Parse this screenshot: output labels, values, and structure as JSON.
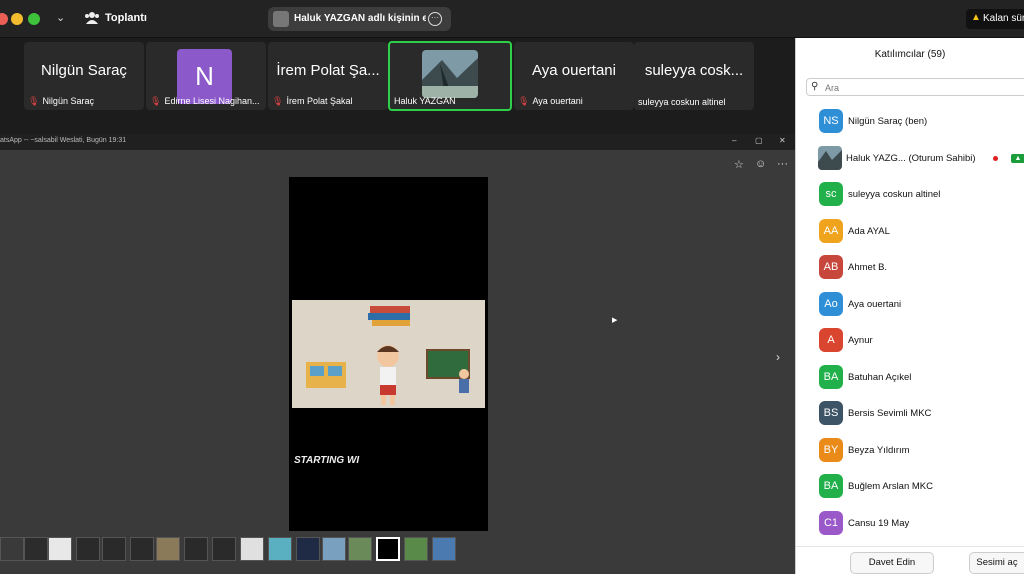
{
  "topbar": {
    "meeting_label": "Toplantı",
    "share_banner": "Haluk YAZGAN adlı kişinin ekranı",
    "time_warning": "Kalan süre"
  },
  "tiles": [
    {
      "name": "Nilgün Saraç",
      "footer": "Nilgün Saraç",
      "muted": true
    },
    {
      "avatar": "N",
      "avatar_color": "#8b59c9",
      "footer": "Edirne Lisesi Nagihan...",
      "muted": true
    },
    {
      "name": "İrem Polat Şa...",
      "footer": "İrem Polat Şakal",
      "muted": true
    },
    {
      "footer": "Haluk YAZGAN",
      "active": true,
      "muted": false
    },
    {
      "name": "Aya ouertani",
      "footer": "Aya ouertani",
      "muted": true
    },
    {
      "name": "suleyya cosk...",
      "footer": "suleyya coskun altinel",
      "muted": false
    }
  ],
  "share": {
    "window_title": "atsApp -- ~salsabil Weslati, Bugün 19:31",
    "video_caption": "STARTING WI"
  },
  "participants": {
    "title": "Katılımcılar (59)",
    "search_placeholder": "Ara",
    "list": [
      {
        "initials": "NS",
        "name": "Nilgün Saraç (ben)",
        "color": "#2f8fd6"
      },
      {
        "initials": "",
        "name": "Haluk YAZG...  (Oturum Sahibi)",
        "color": "#6d6d6d",
        "photo": true
      },
      {
        "initials": "sc",
        "name": "suleyya coskun altinel",
        "color": "#22b04b"
      },
      {
        "initials": "AA",
        "name": "Ada AYAL",
        "color": "#f0a31c"
      },
      {
        "initials": "AB",
        "name": "Ahmet B.",
        "color": "#c8473d"
      },
      {
        "initials": "Ao",
        "name": "Aya ouertani",
        "color": "#2f8fd6"
      },
      {
        "initials": "A",
        "name": "Aynur",
        "color": "#d9452f"
      },
      {
        "initials": "BA",
        "name": "Batuhan Açıkel",
        "color": "#22b04b"
      },
      {
        "initials": "BS",
        "name": "Bersis Sevimli MKC",
        "color": "#3d5366"
      },
      {
        "initials": "BY",
        "name": "Beyza Yıldırım",
        "color": "#e98a19"
      },
      {
        "initials": "BA",
        "name": "Buğlem Arslan MKC",
        "color": "#22b04b"
      },
      {
        "initials": "C1",
        "name": "Cansu 19 May",
        "color": "#9a58c8"
      }
    ],
    "invite_label": "Davet Edin",
    "unmute_label": "Sesimi aç"
  }
}
